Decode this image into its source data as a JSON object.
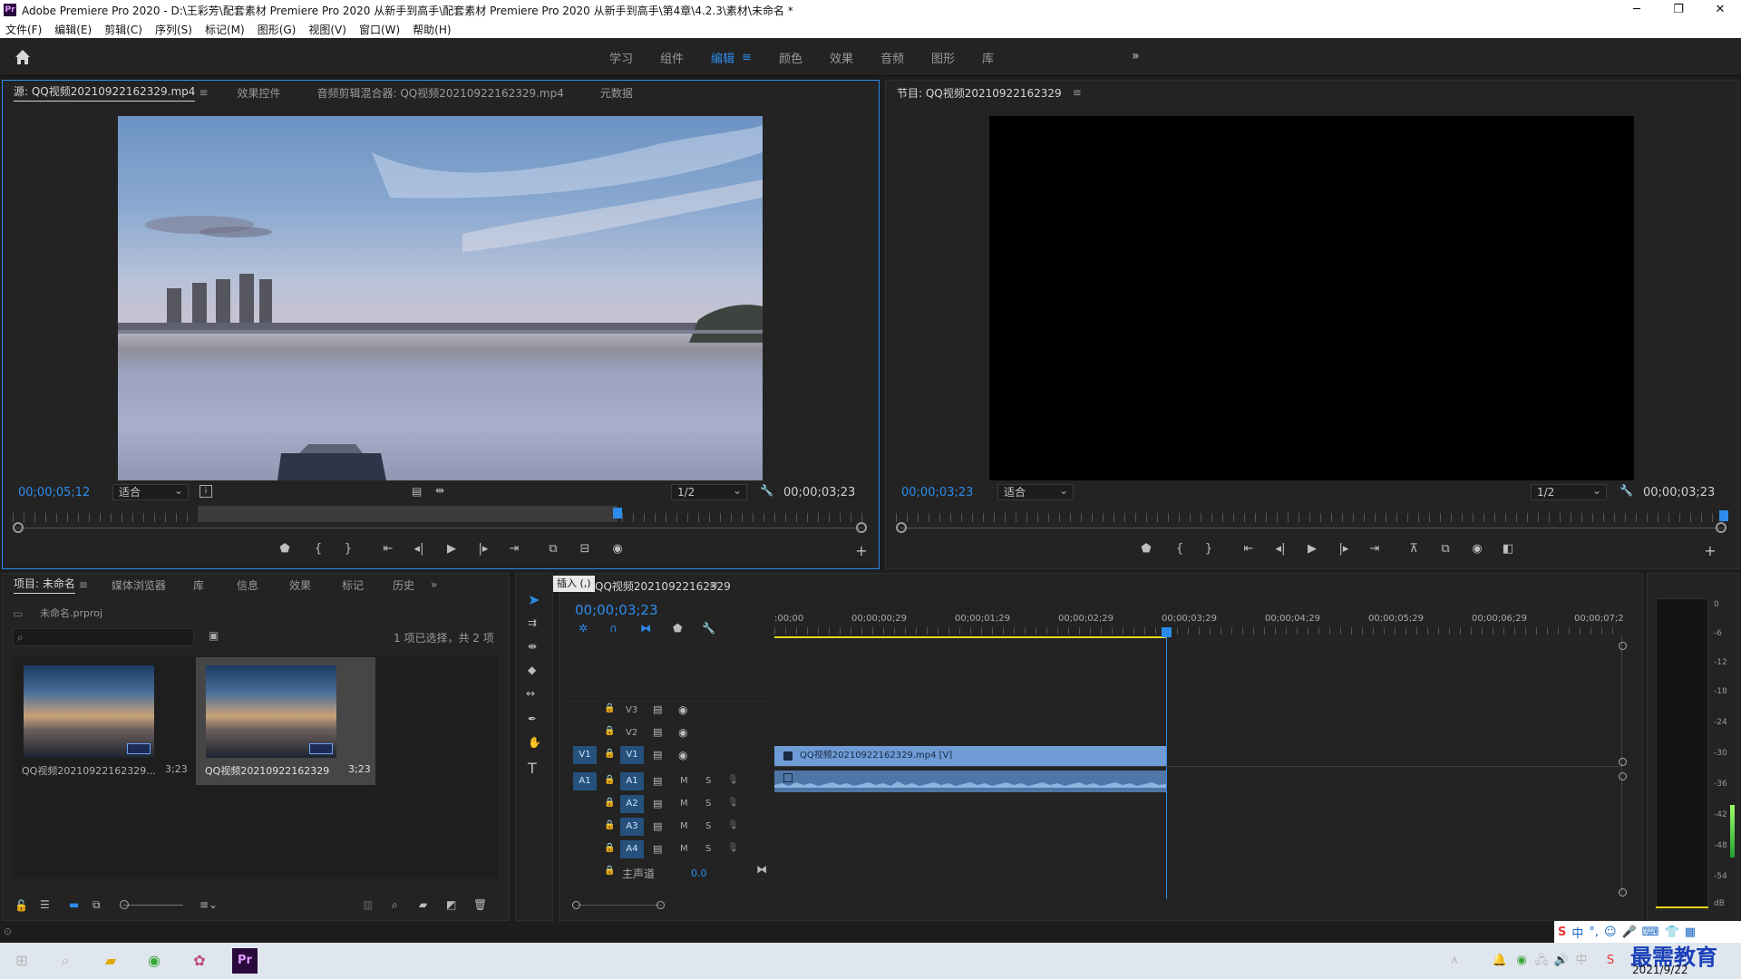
{
  "window": {
    "title": "Adobe Premiere Pro 2020 - D:\\王彩芳\\配套素材 Premiere Pro 2020 从新手到高手\\配套素材 Premiere Pro 2020 从新手到高手\\第4章\\4.2.3\\素材\\未命名 *"
  },
  "menu": [
    "文件(F)",
    "编辑(E)",
    "剪辑(C)",
    "序列(S)",
    "标记(M)",
    "图形(G)",
    "视图(V)",
    "窗口(W)",
    "帮助(H)"
  ],
  "workspaces": {
    "items": [
      "学习",
      "组件",
      "编辑",
      "颜色",
      "效果",
      "音频",
      "图形",
      "库"
    ],
    "active": "编辑"
  },
  "source_panel": {
    "tabs": [
      "源: QQ视频20210922162329.mp4",
      "效果控件",
      "音频剪辑混合器: QQ视频20210922162329.mp4",
      "元数据"
    ],
    "timecode": "00;00;05;12",
    "fit": "适合",
    "resolution": "1/2",
    "duration": "00;00;03;23"
  },
  "program_panel": {
    "tab": "节目: QQ视频20210922162329",
    "timecode": "00;00;03;23",
    "fit": "适合",
    "resolution": "1/2",
    "duration": "00;00;03;23"
  },
  "project_panel": {
    "tabs": [
      "项目: 未命名",
      "媒体浏览器",
      "库",
      "信息",
      "效果",
      "标记",
      "历史"
    ],
    "file": "未命名.prproj",
    "status": "1 项已选择，共 2 项",
    "items": [
      {
        "name": "QQ视频20210922162329...",
        "dur": "3;23"
      },
      {
        "name": "QQ视频20210922162329",
        "dur": "3;23"
      }
    ]
  },
  "timeline": {
    "tooltip": "插入 (,)",
    "tab": "QQ视频20210922162329",
    "timecode": "00;00;03;23",
    "ruler": [
      ":00;00",
      "00;00;00;29",
      "00;00;01;29",
      "00;00;02;29",
      "00;00;03;29",
      "00;00;04;29",
      "00;00;05;29",
      "00;00;06;29",
      "00;00;07;2"
    ],
    "video_tracks": [
      "V3",
      "V2",
      "V1"
    ],
    "audio_tracks": [
      "A1",
      "A2",
      "A3",
      "A4"
    ],
    "src_v": "V1",
    "src_a": "A1",
    "master_label": "主声道",
    "master_value": "0.0",
    "clip_label": "QQ视频20210922162329.mp4 [V]",
    "m": "M",
    "s": "S"
  },
  "meter": {
    "labels": [
      "0",
      "-6",
      "-12",
      "-18",
      "-24",
      "-30",
      "-36",
      "-42",
      "-48",
      "-54",
      "dB"
    ]
  },
  "tray": {
    "date": "2021/9/22",
    "watermark": "最需教育",
    "ime": "中"
  },
  "colors": {
    "accent": "#2d8ceb",
    "playhead": "#2d8ceb",
    "clip_video": "#6f9bd6",
    "clip_audio": "#4e76a6",
    "work_area": "#e5d81a"
  }
}
